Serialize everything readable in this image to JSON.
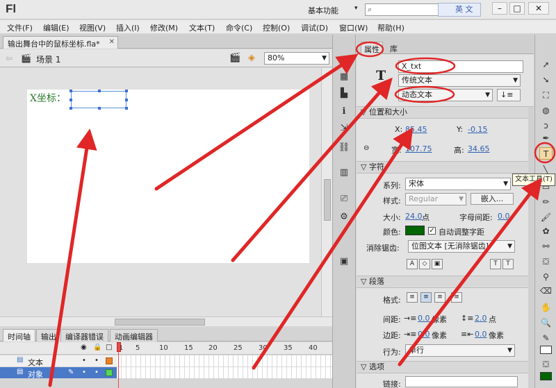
{
  "app": {
    "logo": "Fl",
    "workspace": "基本功能",
    "ime_label": "英 文"
  },
  "menu": [
    "文件(F)",
    "编辑(E)",
    "视图(V)",
    "插入(I)",
    "修改(M)",
    "文本(T)",
    "命令(C)",
    "控制(O)",
    "调试(D)",
    "窗口(W)",
    "帮助(H)"
  ],
  "document": {
    "tab_title": "输出舞台中的鼠标坐标.fla*",
    "scene": "场景 1",
    "zoom": "80%"
  },
  "stage": {
    "text_label": "X坐标："
  },
  "timeline": {
    "tabs": [
      "时间轴",
      "输出",
      "编译器错误",
      "动画编辑器"
    ],
    "frame_numbers": [
      "1",
      "5",
      "10",
      "15",
      "20",
      "25",
      "30",
      "35",
      "40"
    ],
    "layers": [
      {
        "name": "文本",
        "selected": false
      },
      {
        "name": "对象",
        "selected": true
      }
    ]
  },
  "properties": {
    "tabs": [
      "属性",
      "库"
    ],
    "instance_name": "X_txt",
    "text_engine": "传统文本",
    "text_type": "动态文本",
    "position_section": "位置和大小",
    "x_label": "X:",
    "x_value": "85.45",
    "y_label": "Y:",
    "y_value": "-0.15",
    "width_label": "宽:",
    "width_value": "107.75",
    "height_label": "高:",
    "height_value": "34.65",
    "char_section": "字符",
    "family_label": "系列:",
    "family_value": "宋体",
    "style_label": "样式:",
    "style_value": "Regular",
    "embed_label": "嵌入...",
    "size_label": "大小:",
    "size_value": "24.0",
    "size_unit": "点",
    "spacing_label": "字母间距:",
    "spacing_value": "0.0",
    "color_label": "颜色:",
    "auto_kern_label": "自动调整字距",
    "anti_alias_label": "消除锯齿:",
    "anti_alias_value": "位图文本 [无消除锯齿]",
    "para_section": "段落",
    "format_label": "格式:",
    "gap_label": "间距:",
    "gap_indent": "0.0",
    "gap_indent_unit": "像素",
    "gap_line": "2.0",
    "gap_line_unit": "点",
    "margin_label": "边距:",
    "margin_left": "0.0",
    "margin_left_unit": "像素",
    "margin_right": "0.0",
    "margin_right_unit": "像素",
    "behavior_label": "行为:",
    "behavior_value": "单行",
    "options_section": "选项",
    "link_label": "链接:"
  },
  "tooltip": "文本工具(T)",
  "colors": {
    "text_green": "#2e7a2e",
    "swatch_green": "#006600",
    "annotation_red": "#e02626",
    "selection_blue": "#4a79c8"
  }
}
